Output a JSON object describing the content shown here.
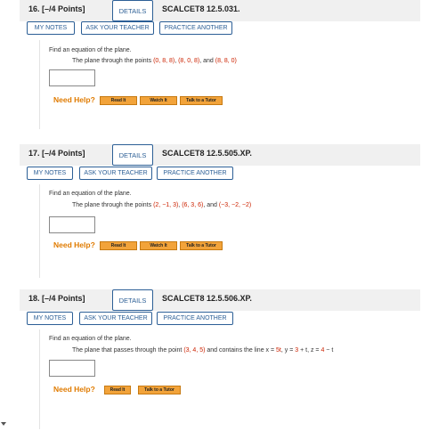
{
  "problems": [
    {
      "number": "16.  [–/4 Points]",
      "details": "DETAILS",
      "code": "SCALCET8 12.5.031.",
      "my_notes": "MY NOTES",
      "ask_teacher": "ASK YOUR TEACHER",
      "practice": "PRACTICE ANOTHER",
      "find": "Find an equation of the plane.",
      "statement_prefix": "The plane through the points ",
      "statement_parts": [
        "(0, 8, 8)",
        ", ",
        "(8, 0, 8)",
        ", and ",
        "(8, 8, 0)"
      ],
      "need_help": "Need Help?",
      "help_buttons": [
        "Read It",
        "Watch It",
        "Talk to a Tutor"
      ]
    },
    {
      "number": "17.  [–/4 Points]",
      "details": "DETAILS",
      "code": "SCALCET8 12.5.505.XP.",
      "my_notes": "MY NOTES",
      "ask_teacher": "ASK YOUR TEACHER",
      "practice": "PRACTICE ANOTHER",
      "find": "Find an equation of the plane.",
      "statement_prefix": "The plane through the points ",
      "statement_parts": [
        "(2, −1, 3)",
        ", ",
        "(6, 3, 6)",
        ", and ",
        "(−3, −2, −2)"
      ],
      "need_help": "Need Help?",
      "help_buttons": [
        "Read It",
        "Watch It",
        "Talk to a Tutor"
      ]
    },
    {
      "number": "18.  [–/4 Points]",
      "details": "DETAILS",
      "code": "SCALCET8 12.5.506.XP.",
      "my_notes": "MY NOTES",
      "ask_teacher": "ASK YOUR TEACHER",
      "practice": "PRACTICE ANOTHER",
      "find": "Find an equation of the plane.",
      "statement_prefix": "The plane that passes through the point ",
      "statement_parts": [
        "(3, 4, 5)",
        " and contains the line  x = ",
        "5t",
        ", y = ",
        "3",
        " + t, z = ",
        "4",
        " − t"
      ],
      "need_help": "Need Help?",
      "help_buttons": [
        "Read It",
        "Talk to a Tutor"
      ]
    }
  ]
}
